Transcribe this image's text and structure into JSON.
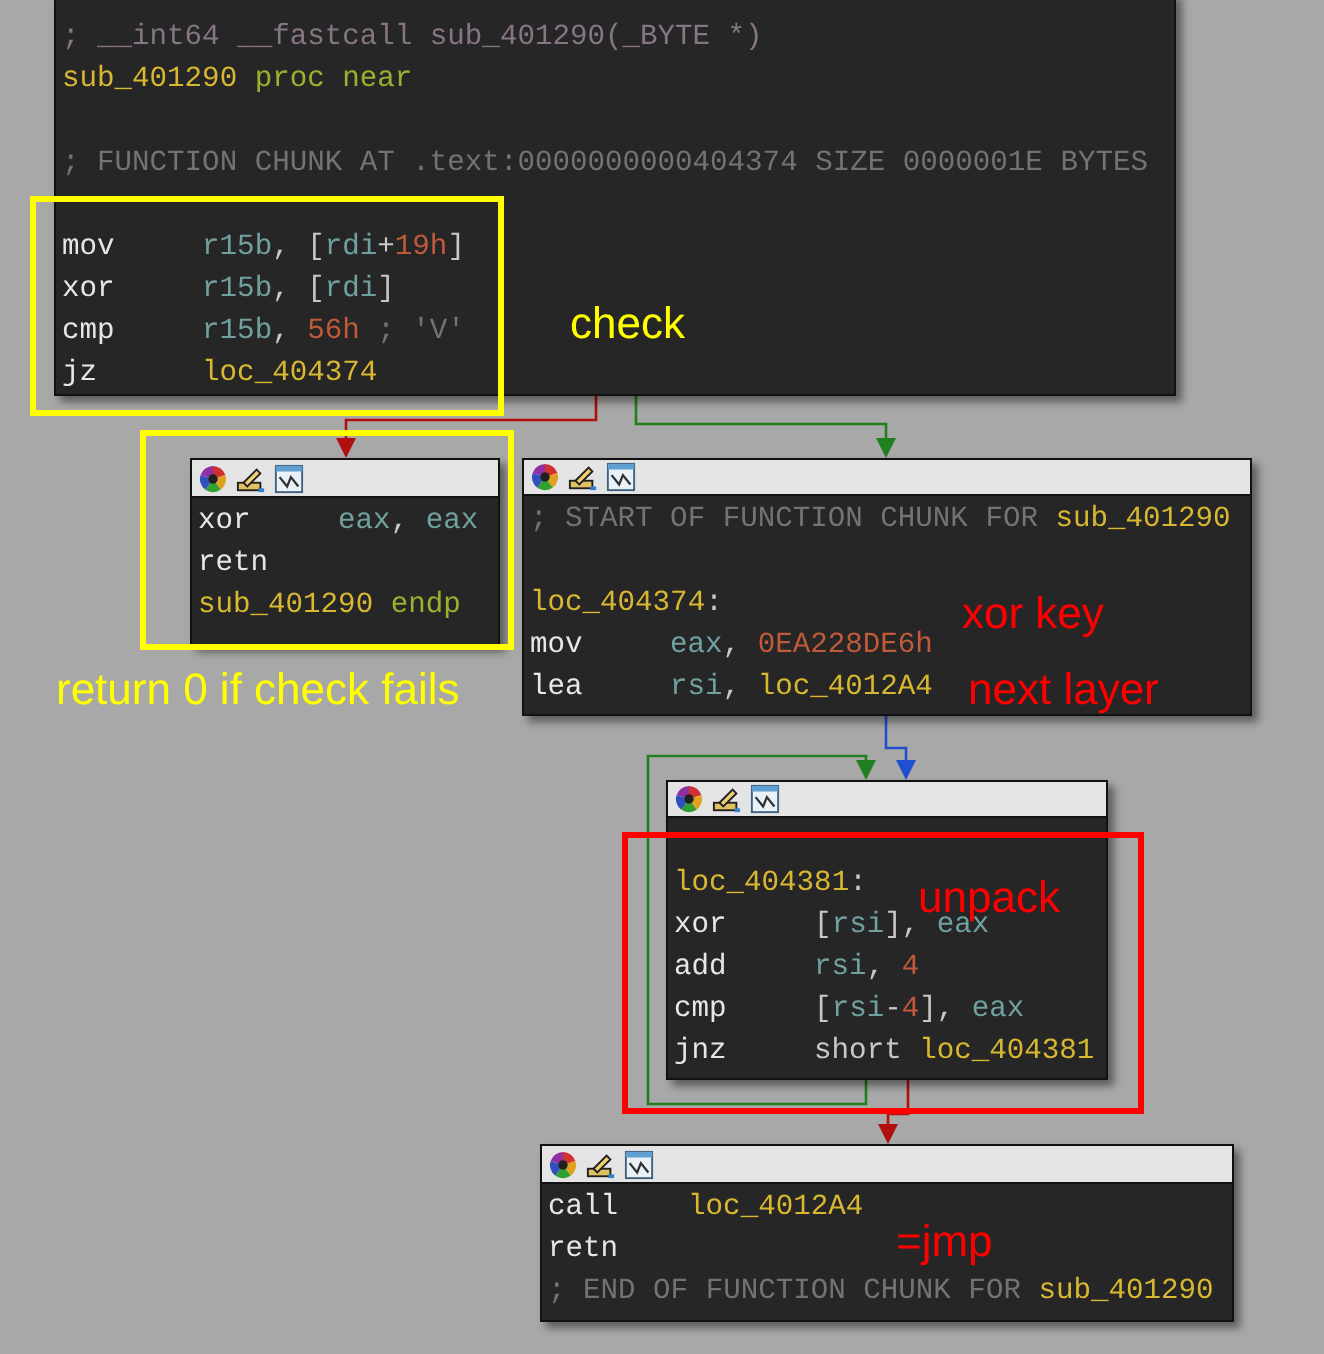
{
  "nodes": [
    {
      "toolbar": false,
      "lines": [
        {
          "kind": "code",
          "tokens": [
            {
              "text": "; __int64 __fastcall sub_401290(_BYTE *)",
              "kind": "typedecl"
            }
          ]
        },
        {
          "kind": "code",
          "tokens": [
            {
              "text": "sub_401290",
              "kind": "name"
            },
            {
              "text": " proc near",
              "kind": "keyword"
            }
          ]
        },
        {
          "kind": "blank"
        },
        {
          "kind": "code",
          "tokens": [
            {
              "text": "; FUNCTION CHUNK AT .text:0000000000404374 SIZE 0000001E BYTES",
              "kind": "comment"
            }
          ]
        },
        {
          "kind": "blank"
        },
        {
          "kind": "code",
          "tokens": [
            {
              "text": "mov",
              "kind": "mnemonic"
            },
            {
              "text": "r15b",
              "kind": "reg"
            },
            {
              "text": ", [",
              "kind": "punct"
            },
            {
              "text": "rdi",
              "kind": "reg"
            },
            {
              "text": "+",
              "kind": "punct"
            },
            {
              "text": "19h",
              "kind": "num"
            },
            {
              "text": "]",
              "kind": "punct"
            }
          ]
        },
        {
          "kind": "code",
          "tokens": [
            {
              "text": "xor",
              "kind": "mnemonic"
            },
            {
              "text": "r15b",
              "kind": "reg"
            },
            {
              "text": ", [",
              "kind": "punct"
            },
            {
              "text": "rdi",
              "kind": "reg"
            },
            {
              "text": "]",
              "kind": "punct"
            }
          ]
        },
        {
          "kind": "code",
          "tokens": [
            {
              "text": "cmp",
              "kind": "mnemonic"
            },
            {
              "text": "r15b",
              "kind": "reg"
            },
            {
              "text": ", ",
              "kind": "punct"
            },
            {
              "text": "56h",
              "kind": "num"
            },
            {
              "text": " ; 'V'",
              "kind": "comment"
            }
          ]
        },
        {
          "kind": "code",
          "tokens": [
            {
              "text": "jz",
              "kind": "mnemonic"
            },
            {
              "text": "loc_404374",
              "kind": "name"
            }
          ]
        }
      ]
    },
    {
      "toolbar": true,
      "lines": [
        {
          "kind": "code",
          "tokens": [
            {
              "text": "xor",
              "kind": "mnemonic"
            },
            {
              "text": "eax",
              "kind": "reg"
            },
            {
              "text": ", ",
              "kind": "punct"
            },
            {
              "text": "eax",
              "kind": "reg"
            }
          ]
        },
        {
          "kind": "code",
          "tokens": [
            {
              "text": "retn",
              "kind": "mnemonic"
            }
          ]
        },
        {
          "kind": "code",
          "tokens": [
            {
              "text": "sub_401290",
              "kind": "name"
            },
            {
              "text": " endp",
              "kind": "keyword"
            }
          ]
        }
      ]
    },
    {
      "toolbar": true,
      "lines": [
        {
          "kind": "code",
          "tokens": [
            {
              "text": "; START OF FUNCTION CHUNK FOR ",
              "kind": "comment"
            },
            {
              "text": "sub_401290",
              "kind": "name"
            }
          ]
        },
        {
          "kind": "blank"
        },
        {
          "kind": "code",
          "tokens": [
            {
              "text": "loc_404374",
              "kind": "name"
            },
            {
              "text": ":",
              "kind": "punct"
            }
          ]
        },
        {
          "kind": "code",
          "tokens": [
            {
              "text": "mov",
              "kind": "mnemonic"
            },
            {
              "text": "eax",
              "kind": "reg"
            },
            {
              "text": ", ",
              "kind": "punct"
            },
            {
              "text": "0EA228DE6h",
              "kind": "num"
            }
          ]
        },
        {
          "kind": "code",
          "tokens": [
            {
              "text": "lea",
              "kind": "mnemonic"
            },
            {
              "text": "rsi",
              "kind": "reg"
            },
            {
              "text": ", ",
              "kind": "punct"
            },
            {
              "text": "loc_4012A4",
              "kind": "name"
            }
          ]
        }
      ]
    },
    {
      "toolbar": true,
      "lines": [
        {
          "kind": "blank"
        },
        {
          "kind": "code",
          "tokens": [
            {
              "text": "loc_404381",
              "kind": "name"
            },
            {
              "text": ":",
              "kind": "punct"
            }
          ]
        },
        {
          "kind": "code",
          "tokens": [
            {
              "text": "xor",
              "kind": "mnemonic"
            },
            {
              "text": "[",
              "kind": "punct"
            },
            {
              "text": "rsi",
              "kind": "reg"
            },
            {
              "text": "], ",
              "kind": "punct"
            },
            {
              "text": "eax",
              "kind": "reg"
            }
          ]
        },
        {
          "kind": "code",
          "tokens": [
            {
              "text": "add",
              "kind": "mnemonic"
            },
            {
              "text": "rsi",
              "kind": "reg"
            },
            {
              "text": ", ",
              "kind": "punct"
            },
            {
              "text": "4",
              "kind": "num"
            }
          ]
        },
        {
          "kind": "code",
          "tokens": [
            {
              "text": "cmp",
              "kind": "mnemonic"
            },
            {
              "text": "[",
              "kind": "punct"
            },
            {
              "text": "rsi",
              "kind": "reg"
            },
            {
              "text": "-",
              "kind": "punct"
            },
            {
              "text": "4",
              "kind": "num"
            },
            {
              "text": "], ",
              "kind": "punct"
            },
            {
              "text": "eax",
              "kind": "reg"
            }
          ]
        },
        {
          "kind": "code",
          "tokens": [
            {
              "text": "jnz",
              "kind": "mnemonic"
            },
            {
              "text": "short ",
              "kind": "punct"
            },
            {
              "text": "loc_404381",
              "kind": "name"
            }
          ]
        }
      ]
    },
    {
      "toolbar": true,
      "lines": [
        {
          "kind": "code",
          "tokens": [
            {
              "text": "call",
              "kind": "mnemonic"
            },
            {
              "text": "loc_4012A4",
              "kind": "name"
            }
          ]
        },
        {
          "kind": "code",
          "tokens": [
            {
              "text": "retn",
              "kind": "mnemonic"
            }
          ]
        },
        {
          "kind": "code",
          "tokens": [
            {
              "text": "; END OF FUNCTION CHUNK FOR ",
              "kind": "comment"
            },
            {
              "text": "sub_401290",
              "kind": "name"
            }
          ]
        }
      ]
    }
  ],
  "edges": [
    {
      "kind": "false"
    },
    {
      "kind": "true"
    },
    {
      "kind": "jump"
    },
    {
      "kind": "true"
    },
    {
      "kind": "false"
    }
  ],
  "frames": [
    {
      "color": "#ffff00"
    },
    {
      "color": "#ffff00"
    },
    {
      "color": "#ff0000"
    }
  ],
  "annotations": [
    {
      "text": "check",
      "color": "#ffff00"
    },
    {
      "text": "return 0 if check fails",
      "color": "#ffff00"
    },
    {
      "text": "xor key",
      "color": "#ff0000"
    },
    {
      "text": "next layer",
      "color": "#ff0000"
    },
    {
      "text": "unpack",
      "color": "#ff0000"
    },
    {
      "text": "=jmp",
      "color": "#ff0000"
    }
  ]
}
